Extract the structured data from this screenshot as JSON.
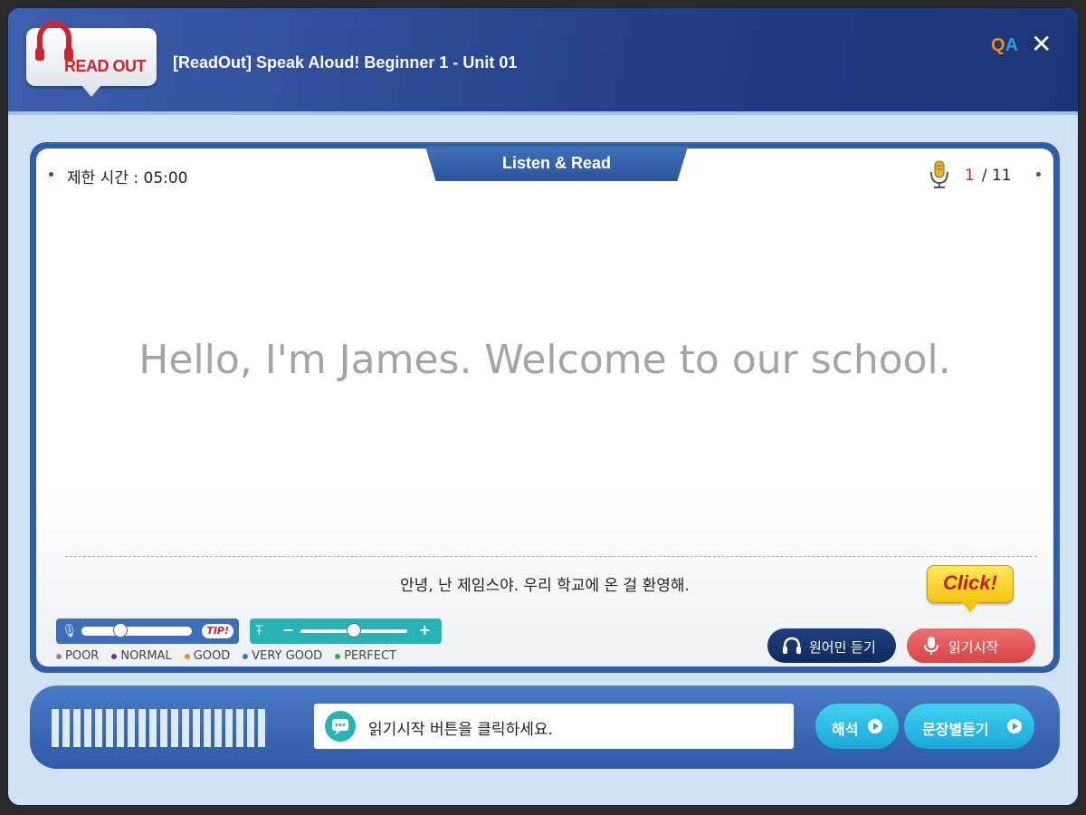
{
  "window": {
    "logo_text": "READ OUT",
    "title": "[ReadOut] Speak Aloud! Beginner 1 - Unit 01",
    "qa_q": "Q",
    "qa_a": "A",
    "close_glyph": "✕"
  },
  "lesson": {
    "tab_title": "Listen & Read",
    "time_limit": "제한 시간 : 05:00",
    "page_current": "1",
    "page_total": "/ 11",
    "sentence": "Hello, I'm James. Welcome to our school.",
    "translation": "안녕, 난 제임스야. 우리 학교에 온 걸 환영해."
  },
  "controls": {
    "click_badge": "Click!",
    "tip_label": "TIP!",
    "sensitivity_level": 0.35,
    "speed_level": 0.5,
    "minus": "−",
    "plus": "+",
    "native_button": "원어민 듣기",
    "read_button": "읽기시작"
  },
  "legend": [
    {
      "label": "POOR",
      "color": "#9a8a78"
    },
    {
      "label": "NORMAL",
      "color": "#6a2fa0"
    },
    {
      "label": "GOOD",
      "color": "#f08a1c"
    },
    {
      "label": "VERY GOOD",
      "color": "#2a7ad0"
    },
    {
      "label": "PERFECT",
      "color": "#2ab04a"
    }
  ],
  "bottom": {
    "message": "읽기시작 버튼을 클릭하세요.",
    "interpret_button": "해석",
    "sentence_listen_button": "문장별듣기"
  },
  "colors": {
    "accent_red": "#d2232a",
    "title_blue": "#1f3a82",
    "teal": "#27b2b5"
  }
}
